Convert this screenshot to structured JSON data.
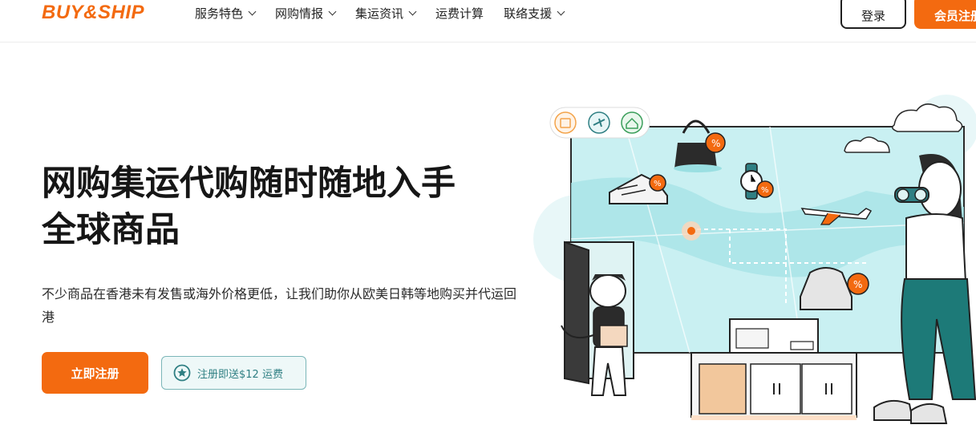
{
  "header": {
    "logo": "BUY&SHIP",
    "nav": [
      {
        "label": "服务特色",
        "has_dropdown": true
      },
      {
        "label": "网购情报",
        "has_dropdown": true
      },
      {
        "label": "集运资讯",
        "has_dropdown": true
      },
      {
        "label": "运费计算",
        "has_dropdown": false
      },
      {
        "label": "联络支援",
        "has_dropdown": true
      }
    ],
    "login_label": "登录",
    "signup_label": "会员注册"
  },
  "hero": {
    "title_line1": "网购集运代购随时随地入手",
    "title_line2": "全球商品",
    "description": "不少商品在香港未有发售或海外价格更低，让我们助你从欧美日韩等地购买并代运回港",
    "primary_button": "立即注册",
    "promo_button": "注册即送$12 运费"
  },
  "colors": {
    "brand_orange": "#f36a10",
    "teal": "#2f7f83",
    "map_blue": "#c9f0f2"
  },
  "icons": [
    "shopping-bag-icon",
    "plane-icon",
    "home-icon",
    "star-icon",
    "chevron-down-icon"
  ]
}
